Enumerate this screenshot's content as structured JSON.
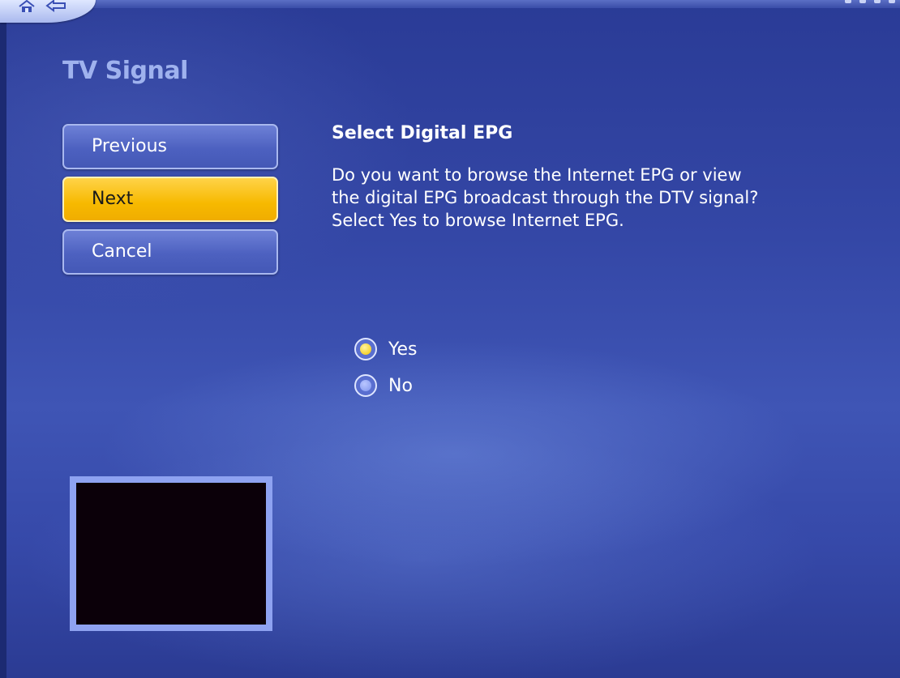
{
  "app": {
    "nav": {
      "home_icon": "home-icon",
      "back_icon": "back-arrow-icon"
    }
  },
  "page": {
    "title": "TV Signal"
  },
  "buttons": {
    "previous": "Previous",
    "next": "Next",
    "cancel": "Cancel",
    "focused": "next"
  },
  "content": {
    "heading": "Select Digital EPG",
    "description_lines": [
      "Do you want to browse the Internet EPG or view",
      "the digital EPG broadcast through the DTV signal?",
      "Select Yes to browse Internet EPG."
    ]
  },
  "options": {
    "selected": "Yes",
    "items": [
      {
        "label": "Yes"
      },
      {
        "label": "No"
      }
    ]
  },
  "colors": {
    "background": "#3447a6",
    "focus": "#f7b900",
    "button": "#4d61c0",
    "title": "#9fb2ee"
  }
}
